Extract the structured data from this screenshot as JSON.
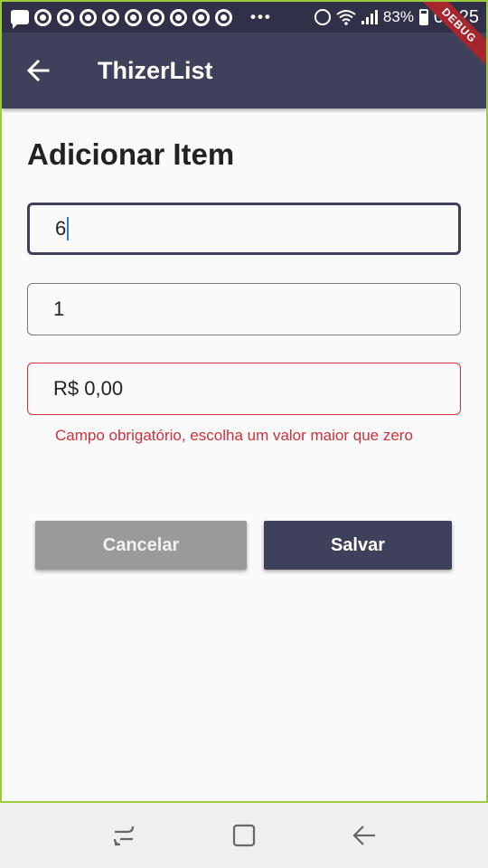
{
  "status_bar": {
    "battery": "83%",
    "time": "00:25",
    "icons": [
      "message-icon",
      "chrome-icon",
      "chrome-icon",
      "chrome-icon",
      "chrome-icon",
      "chrome-icon",
      "chrome-icon",
      "chrome-icon",
      "chrome-icon",
      "chrome-icon",
      "more-notifications-icon",
      "alarm-icon",
      "wifi-icon",
      "signal-icon",
      "battery-icon"
    ]
  },
  "app_bar": {
    "title": "ThizerList",
    "back_icon": "arrow-back-icon",
    "debug_banner": "DEBUG"
  },
  "form": {
    "heading": "Adicionar Item",
    "name_field": {
      "value": "6"
    },
    "quantity_field": {
      "value": "1"
    },
    "price_field": {
      "value": "R$ 0,00",
      "error": "Campo obrigatório, escolha um valor maior que zero"
    }
  },
  "actions": {
    "cancel_label": "Cancelar",
    "save_label": "Salvar"
  },
  "colors": {
    "primary": "#3f4059",
    "error": "#d0303a",
    "cancel": "#9a9a9a"
  },
  "nav_bar": {
    "icons": [
      "recents-icon",
      "home-icon",
      "back-icon"
    ]
  }
}
